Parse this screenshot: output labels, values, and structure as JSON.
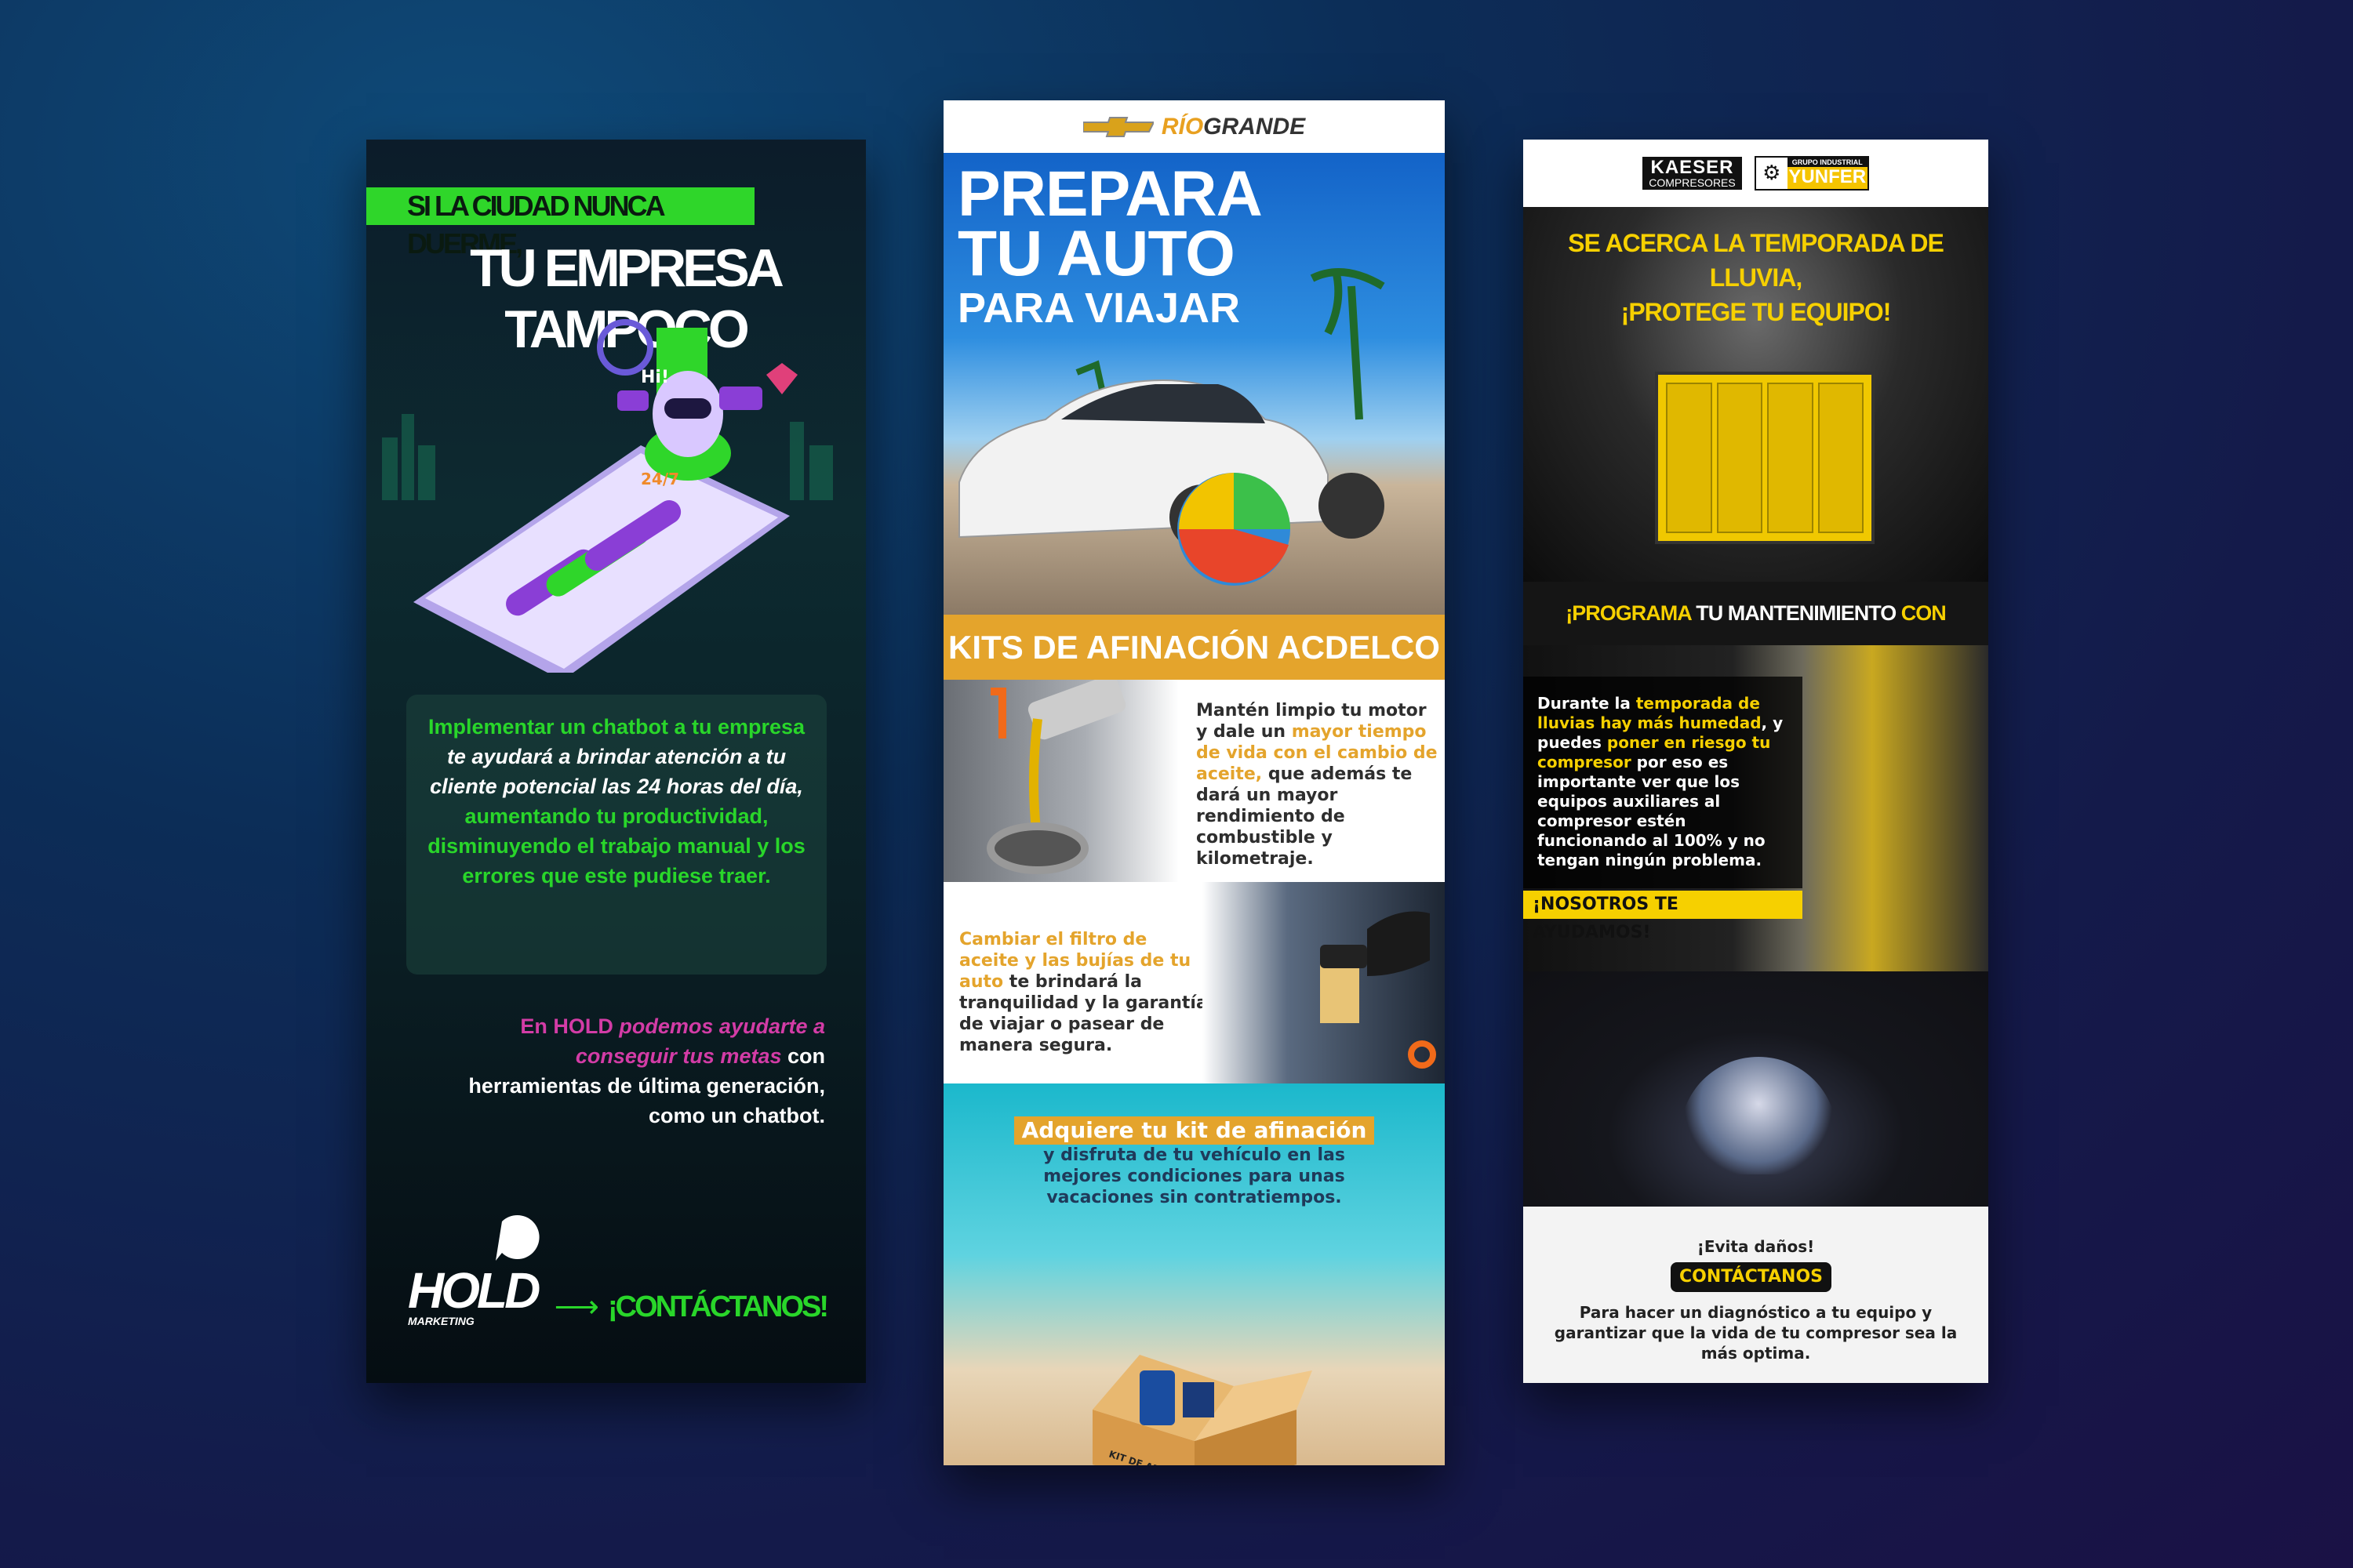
{
  "hold": {
    "tag": "SI LA CIUDAD NUNCA DUERME,",
    "headline": "TU EMPRESA TAMPOCO",
    "illustration_labels": {
      "hi": "Hi!",
      "h24": "24/7"
    },
    "box": [
      {
        "text": "Implementar un chatbot a tu empresa",
        "style": "green"
      },
      {
        "text": " te ayudará a brindar atención a tu cliente potencial las 24 horas del día,",
        "style": "white-italic"
      },
      {
        "text": " aumentando tu productividad, disminuyendo el trabajo manual y los errores que este pudiese traer.",
        "style": "green"
      }
    ],
    "pitch": [
      {
        "text": "En HOLD ",
        "style": "pink"
      },
      {
        "text": "podemos ayudarte a conseguir tus metas",
        "style": "pink-italic"
      },
      {
        "text": " con herramientas de última generación, como un chatbot.",
        "style": "white"
      }
    ],
    "logo": {
      "name": "HOLD",
      "sub": "MARKETING"
    },
    "cta": "¡CONTÁCTANOS!",
    "colors": {
      "accent": "#29d62a",
      "pink": "#d33ca6"
    }
  },
  "riogrande": {
    "brand_a": "RÍO",
    "brand_b": "GRANDE",
    "title_lines": [
      "PREPARA",
      "TU AUTO"
    ],
    "title_last": "PARA VIAJAR",
    "band": "KITS DE AFINACIÓN ACDELCO",
    "section1": [
      {
        "text": "Mantén limpio tu motor y dale un ",
        "style": "dark"
      },
      {
        "text": "mayor tiempo de vida con el cambio de aceite,",
        "style": "orange"
      },
      {
        "text": " que además te dará un mayor rendimiento de combustible y kilometraje.",
        "style": "dark"
      }
    ],
    "section2": [
      {
        "text": "Cambiar el filtro de aceite y las bujías de tu auto",
        "style": "orange"
      },
      {
        "text": " te brindará la tranquilidad y la garantía de viajar o pasear de manera segura.",
        "style": "dark"
      }
    ],
    "section3_label": "Adquiere tu kit de afinación",
    "section3_text": "y disfruta de tu vehículo en las mejores condiciones para unas vacaciones sin contratiempos.",
    "box_label": "KIT DE AFINACIÓN",
    "colors": {
      "accent": "#e4a42c",
      "sky": "#1363c8",
      "sea": "#1bb8cc"
    }
  },
  "kaeser": {
    "logo_kaeser": "KAESER",
    "logo_kaeser_sub": "COMPRESORES",
    "logo_yunfer_top": "GRUPO INDUSTRIAL",
    "logo_yunfer": "YUNFER",
    "title_line1": "SE ACERCA LA TEMPORADA DE LLUVIA,",
    "title_line2": "¡PROTEGE TU EQUIPO!",
    "band": [
      {
        "text": "¡PROGRAMA ",
        "style": "yellow"
      },
      {
        "text": "TU MANTENIMIENTO ",
        "style": "white"
      },
      {
        "text": "CON NOSOTROS!",
        "style": "yellow"
      }
    ],
    "body": [
      {
        "text": "Durante la ",
        "style": "white"
      },
      {
        "text": "temporada de lluvias hay más humedad",
        "style": "yellow"
      },
      {
        "text": ", y puedes ",
        "style": "white"
      },
      {
        "text": "poner en riesgo tu compresor",
        "style": "yellow"
      },
      {
        "text": " por eso es importante ver que los equipos auxiliares al compresor estén funcionando al 100% y no tengan ningún problema.",
        "style": "white"
      }
    ],
    "help": "¡NOSOTROS TE AYUDAMOS!",
    "evita": "¡Evita daños!",
    "button": "CONTÁCTANOS",
    "closing": "Para hacer un diagnóstico a tu equipo y garantizar que la vida de tu compresor sea la más optima.",
    "colors": {
      "accent": "#f6d000"
    }
  }
}
